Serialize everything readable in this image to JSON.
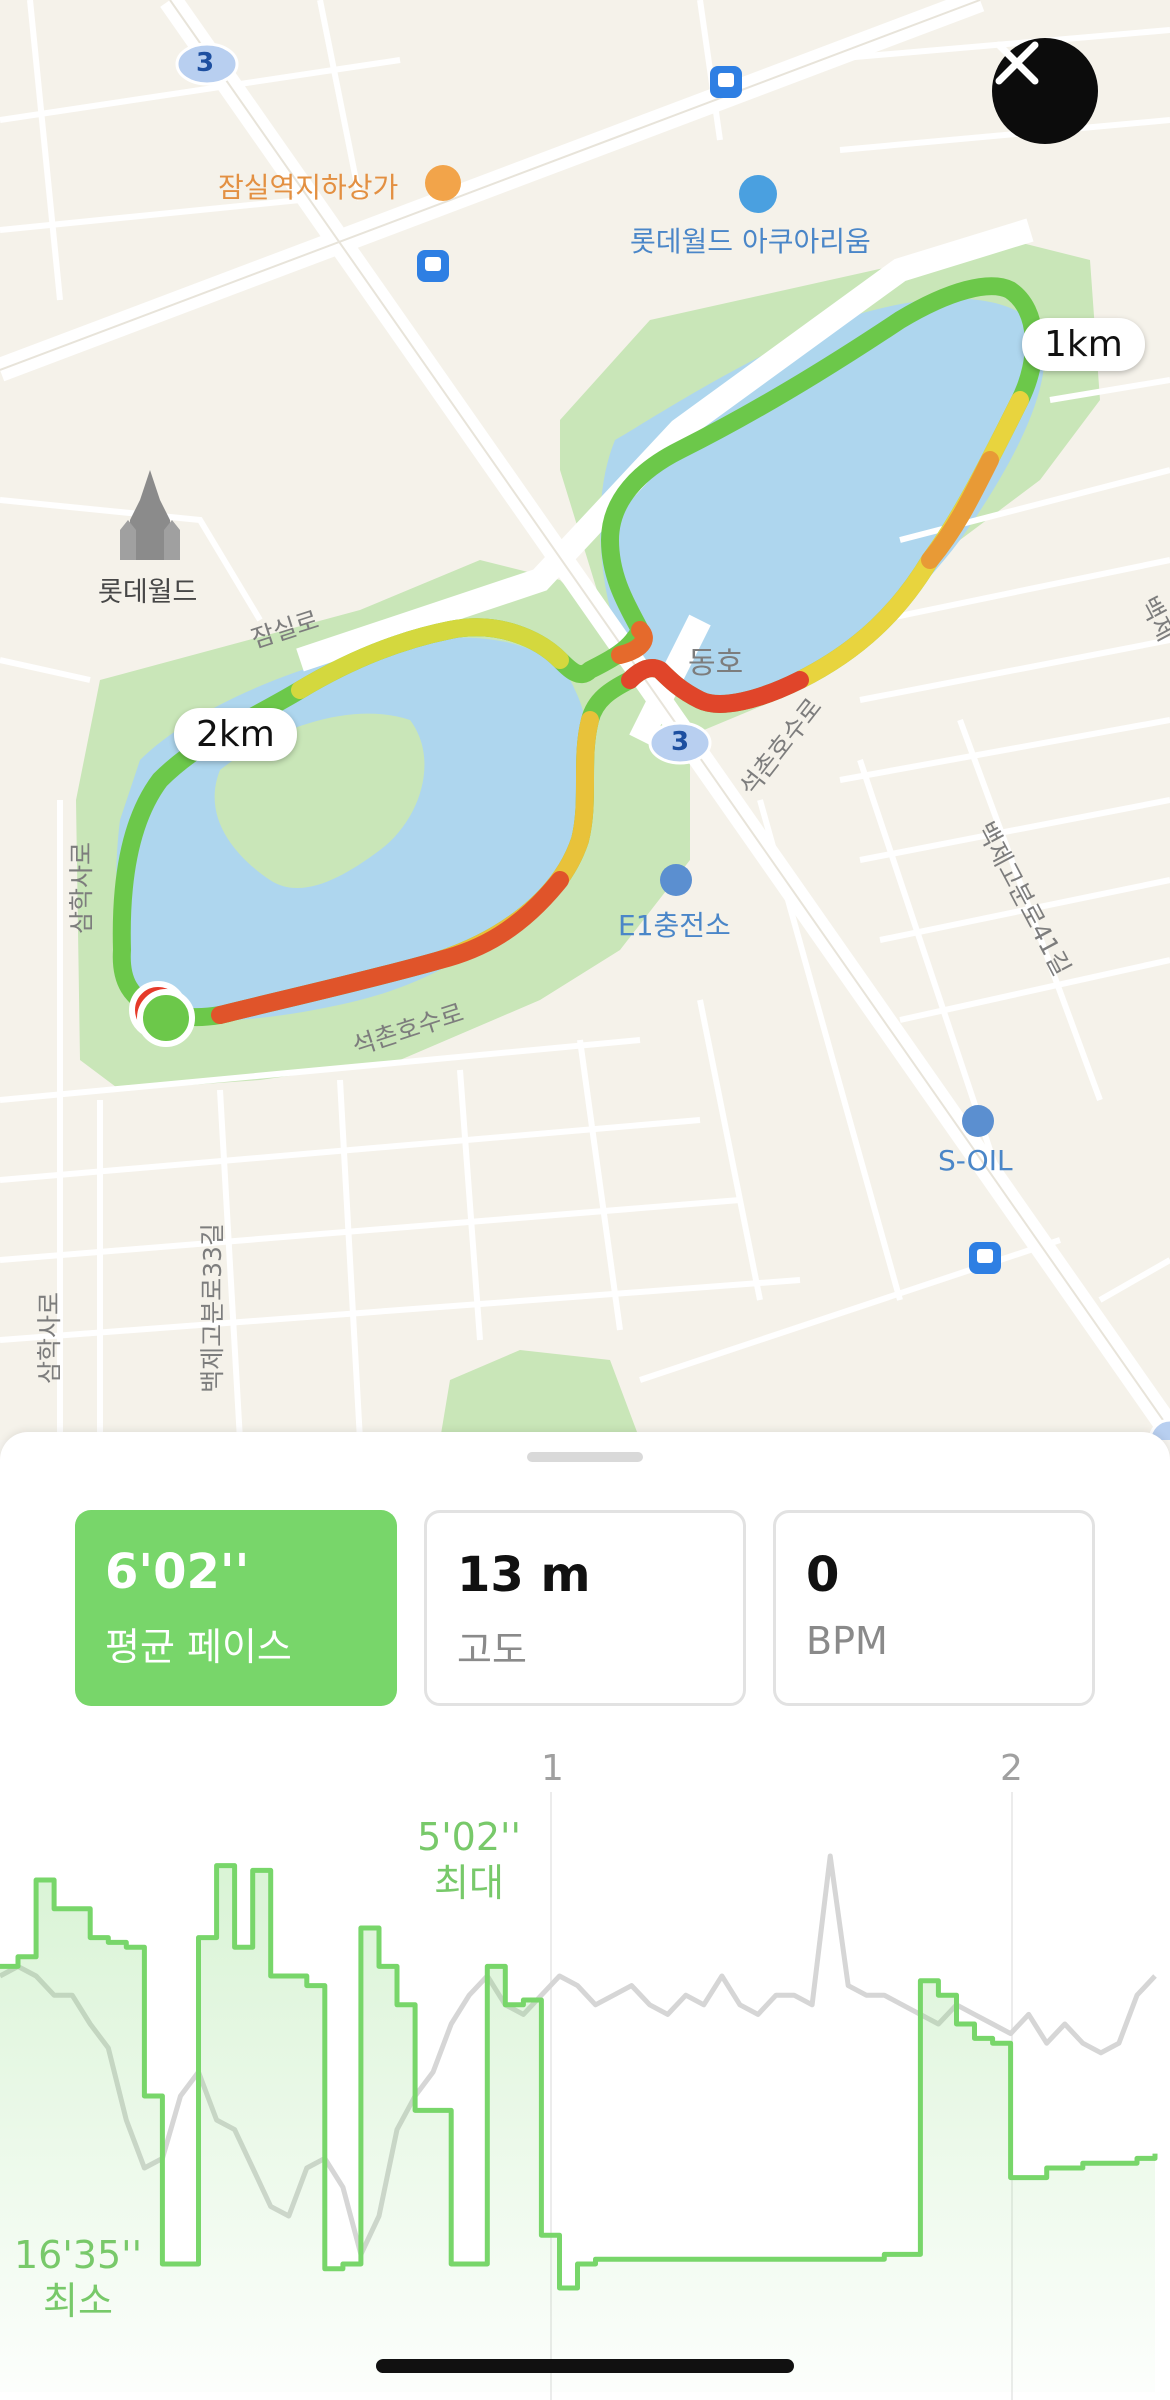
{
  "map": {
    "labels": {
      "station_underground": "잠실역지하상가",
      "aquarium": "롯데월드 아쿠아리움",
      "lotteworld": "롯데월드",
      "jamsil_ro": "잠실로",
      "dongho": "동호",
      "seokchon_ro_east": "석촌호수로",
      "seokchon_ro_south": "석촌호수로",
      "e1_station": "E1충전소",
      "soil": "S-OIL",
      "baekje_41": "백제고분로41길",
      "baekje_33": "백제고분로33길",
      "samhak_1": "삼학사로",
      "samhak_2": "삼학사로",
      "baekje_edge": "백제"
    },
    "route_shields": [
      "3",
      "3"
    ],
    "distance_markers": [
      "1km",
      "2km"
    ],
    "route_colors": {
      "fast": "#6cc84a",
      "mid": "#e3e042",
      "slow": "#e0452a"
    }
  },
  "sheet": {
    "cards": [
      {
        "value": "6'02''",
        "caption": "평균 페이스",
        "active": true
      },
      {
        "value": "13 m",
        "caption": "고도",
        "active": false
      },
      {
        "value": "0",
        "caption": "BPM",
        "active": false
      }
    ],
    "km_marks": [
      "1",
      "2"
    ],
    "chart": {
      "max_value": "5'02''",
      "max_label": "최대",
      "min_value": "16'35''",
      "min_label": "최소",
      "pace_color": "#78d66a",
      "elevation_color": "#d6d6d6"
    }
  },
  "chart_data": {
    "type": "line",
    "series": [
      {
        "values": [
          0.72,
          0.74,
          0.9,
          0.84,
          0.84,
          0.78,
          0.77,
          0.76,
          0.45,
          0.1,
          0.1,
          0.78,
          0.93,
          0.76,
          0.92,
          0.7,
          0.7,
          0.68,
          0.09,
          0.1,
          0.8,
          0.72,
          0.64,
          0.42,
          0.42,
          0.1,
          0.1,
          0.72,
          0.64,
          0.65,
          0.16,
          0.05,
          0.1,
          0.11,
          0.11,
          0.11,
          0.11,
          0.11,
          0.11,
          0.11,
          0.11,
          0.11,
          0.11,
          0.11,
          0.11,
          0.11,
          0.11,
          0.11,
          0.11,
          0.12,
          0.12,
          0.69,
          0.66,
          0.6,
          0.57,
          0.56,
          0.28,
          0.28,
          0.3,
          0.3,
          0.31,
          0.31,
          0.31,
          0.32,
          0.33
        ]
      },
      {
        "values": [
          0.7,
          0.72,
          0.7,
          0.66,
          0.66,
          0.6,
          0.55,
          0.4,
          0.3,
          0.32,
          0.45,
          0.5,
          0.4,
          0.38,
          0.3,
          0.22,
          0.2,
          0.3,
          0.32,
          0.26,
          0.12,
          0.2,
          0.38,
          0.45,
          0.5,
          0.6,
          0.66,
          0.7,
          0.64,
          0.62,
          0.66,
          0.7,
          0.68,
          0.64,
          0.66,
          0.68,
          0.64,
          0.62,
          0.66,
          0.64,
          0.7,
          0.64,
          0.62,
          0.66,
          0.66,
          0.64,
          0.95,
          0.68,
          0.66,
          0.66,
          0.64,
          0.62,
          0.6,
          0.64,
          0.62,
          0.6,
          0.58,
          0.62,
          0.56,
          0.6,
          0.56,
          0.54,
          0.56,
          0.66,
          0.7
        ]
      }
    ]
  }
}
